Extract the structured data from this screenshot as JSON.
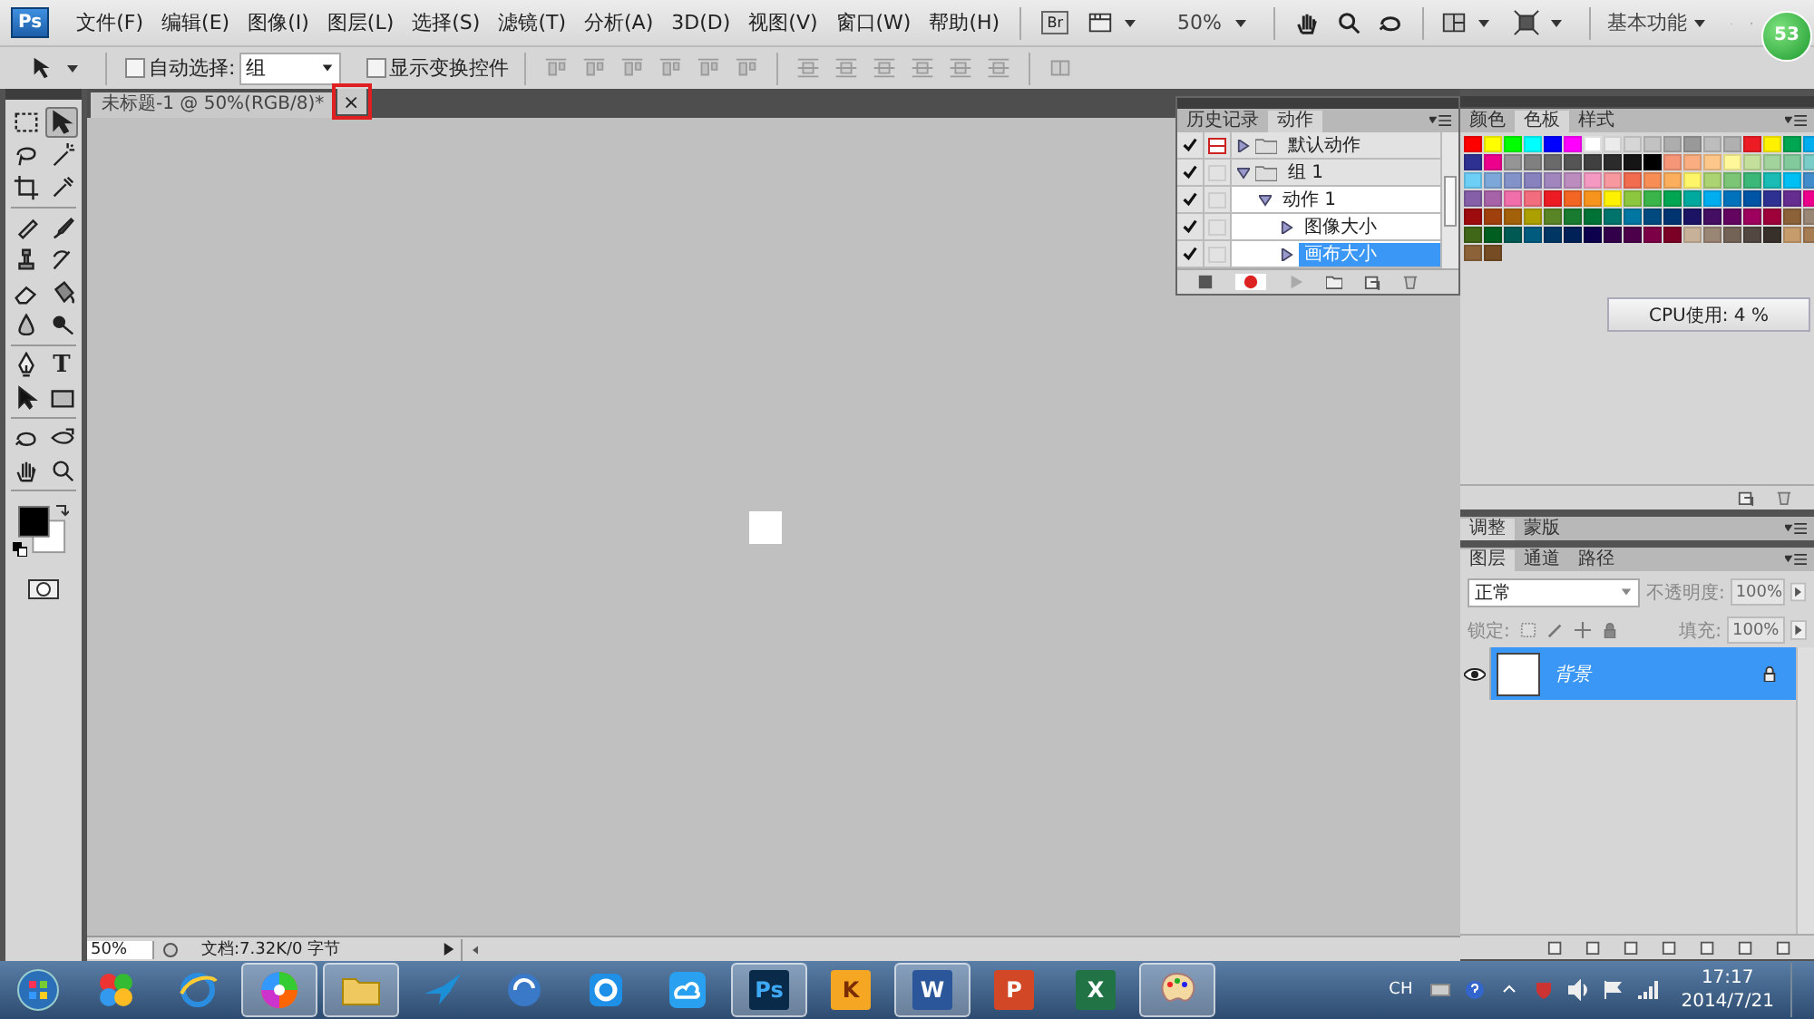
{
  "app": {
    "logo": "Ps",
    "menus": [
      "文件(F)",
      "编辑(E)",
      "图像(I)",
      "图层(L)",
      "选择(S)",
      "滤镜(T)",
      "分析(A)",
      "3D(D)",
      "视图(V)",
      "窗口(W)",
      "帮助(H)"
    ],
    "bridge": "Br",
    "zoom": "50%",
    "workspace": "基本功能",
    "badge": "53"
  },
  "options": {
    "auto_select": {
      "label": "自动选择:",
      "checked": false
    },
    "auto_select_target": "组",
    "transform": {
      "label": "显示变换控件",
      "checked": false
    }
  },
  "tools": [
    {
      "kind": "marquee",
      "selected": false
    },
    {
      "kind": "move",
      "selected": true
    },
    {
      "kind": "lasso",
      "selected": false
    },
    {
      "kind": "wand",
      "selected": false
    },
    {
      "kind": "crop",
      "selected": false
    },
    {
      "kind": "eyedropper",
      "selected": false
    },
    {
      "kind": "healing",
      "selected": false
    },
    {
      "kind": "brush",
      "selected": false
    },
    {
      "kind": "stamp",
      "selected": false
    },
    {
      "kind": "history",
      "selected": false
    },
    {
      "kind": "eraser",
      "selected": false
    },
    {
      "kind": "bucket",
      "selected": false
    },
    {
      "kind": "blur",
      "selected": false
    },
    {
      "kind": "dodge",
      "selected": false
    },
    {
      "kind": "pen",
      "selected": false
    },
    {
      "kind": "type",
      "label": "T",
      "selected": false
    },
    {
      "kind": "pathselect",
      "selected": false
    },
    {
      "kind": "shape",
      "selected": false
    },
    {
      "kind": "rotate3d",
      "selected": false
    },
    {
      "kind": "orbit3d",
      "selected": false
    },
    {
      "kind": "hand",
      "selected": false
    },
    {
      "kind": "zoom",
      "selected": false
    }
  ],
  "document": {
    "tab": "未标题-1 @ 50%(RGB/8)*",
    "close": "×",
    "close_highlighted": true,
    "zoom": "50%",
    "info": "文档:7.32K/0 字节"
  },
  "actions_panel": {
    "tabs": [
      {
        "label": "历史记录",
        "selected": false
      },
      {
        "label": "动作",
        "selected": true
      }
    ],
    "items": [
      {
        "name": "默认动作",
        "set": true,
        "enabled": true,
        "dialog": true,
        "expanded": false,
        "selected": false
      },
      {
        "name": "组 1",
        "set": true,
        "enabled": true,
        "dialog": false,
        "expanded": true,
        "selected": false,
        "children": [
          {
            "name": "动作 1",
            "set": false,
            "enabled": true,
            "dialog": false,
            "expanded": true,
            "selected": false,
            "children": [
              {
                "name": "图像大小",
                "set": false,
                "enabled": true,
                "dialog": false,
                "expanded": false,
                "selected": false
              },
              {
                "name": "画布大小",
                "set": false,
                "enabled": true,
                "dialog": false,
                "expanded": false,
                "selected": true
              }
            ]
          }
        ]
      }
    ]
  },
  "swatches_panel": {
    "tabs": [
      {
        "label": "颜色",
        "selected": false
      },
      {
        "label": "色板",
        "selected": true
      },
      {
        "label": "样式",
        "selected": false
      }
    ],
    "swatches": [
      {
        "color": "#ff0000"
      },
      {
        "color": "#ffff00"
      },
      {
        "color": "#00ff00"
      },
      {
        "color": "#00ffff"
      },
      {
        "color": "#0000ff"
      },
      {
        "color": "#ff00ff"
      },
      {
        "color": "#ffffff"
      },
      {
        "color": "#ebebeb"
      },
      {
        "color": "#d6d6d6"
      },
      {
        "color": "#c2c2c2"
      },
      {
        "color": "#adadad"
      },
      {
        "color": "#999999"
      },
      {
        "color": "#bdbdbd"
      },
      {
        "color": "#b0b0b0"
      },
      {
        "color": "#ed1c24"
      },
      {
        "color": "#fff200"
      },
      {
        "color": "#00a651"
      },
      {
        "color": "#00aeef"
      },
      {
        "color": "#2e3192"
      },
      {
        "color": "#ec008c"
      },
      {
        "color": "#959595"
      },
      {
        "color": "#808080"
      },
      {
        "color": "#6a6a6a"
      },
      {
        "color": "#555555"
      },
      {
        "color": "#404040"
      },
      {
        "color": "#2b2b2b"
      },
      {
        "color": "#151515"
      },
      {
        "color": "#000000"
      },
      {
        "color": "#f69679"
      },
      {
        "color": "#f9ad81"
      },
      {
        "color": "#fdc68a"
      },
      {
        "color": "#fff799"
      },
      {
        "color": "#c4df9b"
      },
      {
        "color": "#a3d39c"
      },
      {
        "color": "#82ca9c"
      },
      {
        "color": "#7accc8"
      },
      {
        "color": "#6dcff6"
      },
      {
        "color": "#7da7d9"
      },
      {
        "color": "#8393ca"
      },
      {
        "color": "#8781bd"
      },
      {
        "color": "#a186be"
      },
      {
        "color": "#bd8cbf"
      },
      {
        "color": "#f49ac2"
      },
      {
        "color": "#f6989d"
      },
      {
        "color": "#f26c4f"
      },
      {
        "color": "#f68e56"
      },
      {
        "color": "#fbaf5d"
      },
      {
        "color": "#fff568"
      },
      {
        "color": "#acd372"
      },
      {
        "color": "#7cc576"
      },
      {
        "color": "#3bb878"
      },
      {
        "color": "#1abbb4"
      },
      {
        "color": "#00bff3"
      },
      {
        "color": "#438ccb"
      },
      {
        "color": "#855fa8"
      },
      {
        "color": "#a763a8"
      },
      {
        "color": "#f06eaa"
      },
      {
        "color": "#f26d7d"
      },
      {
        "color": "#ed1c24"
      },
      {
        "color": "#f26522"
      },
      {
        "color": "#f7941d"
      },
      {
        "color": "#fff200"
      },
      {
        "color": "#8dc63f"
      },
      {
        "color": "#39b54a"
      },
      {
        "color": "#00a651"
      },
      {
        "color": "#00a99d"
      },
      {
        "color": "#00aeef"
      },
      {
        "color": "#0072bc"
      },
      {
        "color": "#0054a6"
      },
      {
        "color": "#2e3192"
      },
      {
        "color": "#662d91"
      },
      {
        "color": "#ec008c"
      },
      {
        "color": "#9e0b0f"
      },
      {
        "color": "#a0410d"
      },
      {
        "color": "#a3620a"
      },
      {
        "color": "#aba000"
      },
      {
        "color": "#598527"
      },
      {
        "color": "#197b30"
      },
      {
        "color": "#007236"
      },
      {
        "color": "#00746b"
      },
      {
        "color": "#0076a3"
      },
      {
        "color": "#004a80"
      },
      {
        "color": "#003471"
      },
      {
        "color": "#1b1464"
      },
      {
        "color": "#440e62"
      },
      {
        "color": "#630460"
      },
      {
        "color": "#9e005d"
      },
      {
        "color": "#9e0039"
      },
      {
        "color": "#8c6239"
      },
      {
        "color": "#998675"
      },
      {
        "color": "#406618"
      },
      {
        "color": "#005e20"
      },
      {
        "color": "#005952"
      },
      {
        "color": "#005b7f"
      },
      {
        "color": "#003663"
      },
      {
        "color": "#002157"
      },
      {
        "color": "#0d004c"
      },
      {
        "color": "#32004b"
      },
      {
        "color": "#4b0049"
      },
      {
        "color": "#7b0046"
      },
      {
        "color": "#7a0026"
      },
      {
        "color": "#c7b299"
      },
      {
        "color": "#998675"
      },
      {
        "color": "#736357"
      },
      {
        "color": "#534741"
      },
      {
        "color": "#37302a"
      },
      {
        "color": "#c69c6d"
      },
      {
        "color": "#a67c52"
      },
      {
        "color": "#8c6239"
      },
      {
        "color": "#754c24"
      }
    ]
  },
  "cpu": "CPU使用: 4 %",
  "adjustments_panel": {
    "tabs": [
      {
        "label": "调整",
        "selected": true
      },
      {
        "label": "蒙版",
        "selected": false
      }
    ]
  },
  "layers_panel": {
    "tabs": [
      {
        "label": "图层",
        "selected": true
      },
      {
        "label": "通道",
        "selected": false
      },
      {
        "label": "路径",
        "selected": false
      }
    ],
    "blend_mode": "正常",
    "opacity_label": "不透明度:",
    "opacity": "100%",
    "lock_label": "锁定:",
    "fill_label": "填充:",
    "fill": "100%",
    "layers": [
      {
        "name": "背景",
        "visible": true,
        "locked": true,
        "selected": true
      }
    ]
  },
  "taskbar": {
    "apps": [
      {
        "kind": "start",
        "running": false
      },
      {
        "kind": "squares",
        "running": false
      },
      {
        "kind": "browser",
        "running": false
      },
      {
        "kind": "wheel",
        "running": true
      },
      {
        "kind": "folder",
        "running": true
      },
      {
        "kind": "bird",
        "running": false
      },
      {
        "kind": "sync",
        "running": false
      },
      {
        "kind": "ring",
        "running": false
      },
      {
        "kind": "cloud",
        "running": false
      },
      {
        "kind": "tile",
        "label": "Ps",
        "running": true
      },
      {
        "kind": "tile",
        "label": "K",
        "running": false
      },
      {
        "kind": "tile",
        "label": "W",
        "running": true
      },
      {
        "kind": "tile",
        "label": "P",
        "running": false
      },
      {
        "kind": "tile",
        "label": "X",
        "running": false
      },
      {
        "kind": "palette",
        "running": true
      }
    ],
    "tray": {
      "language": "CH",
      "time": "17:17",
      "date": "2014/7/21"
    }
  }
}
